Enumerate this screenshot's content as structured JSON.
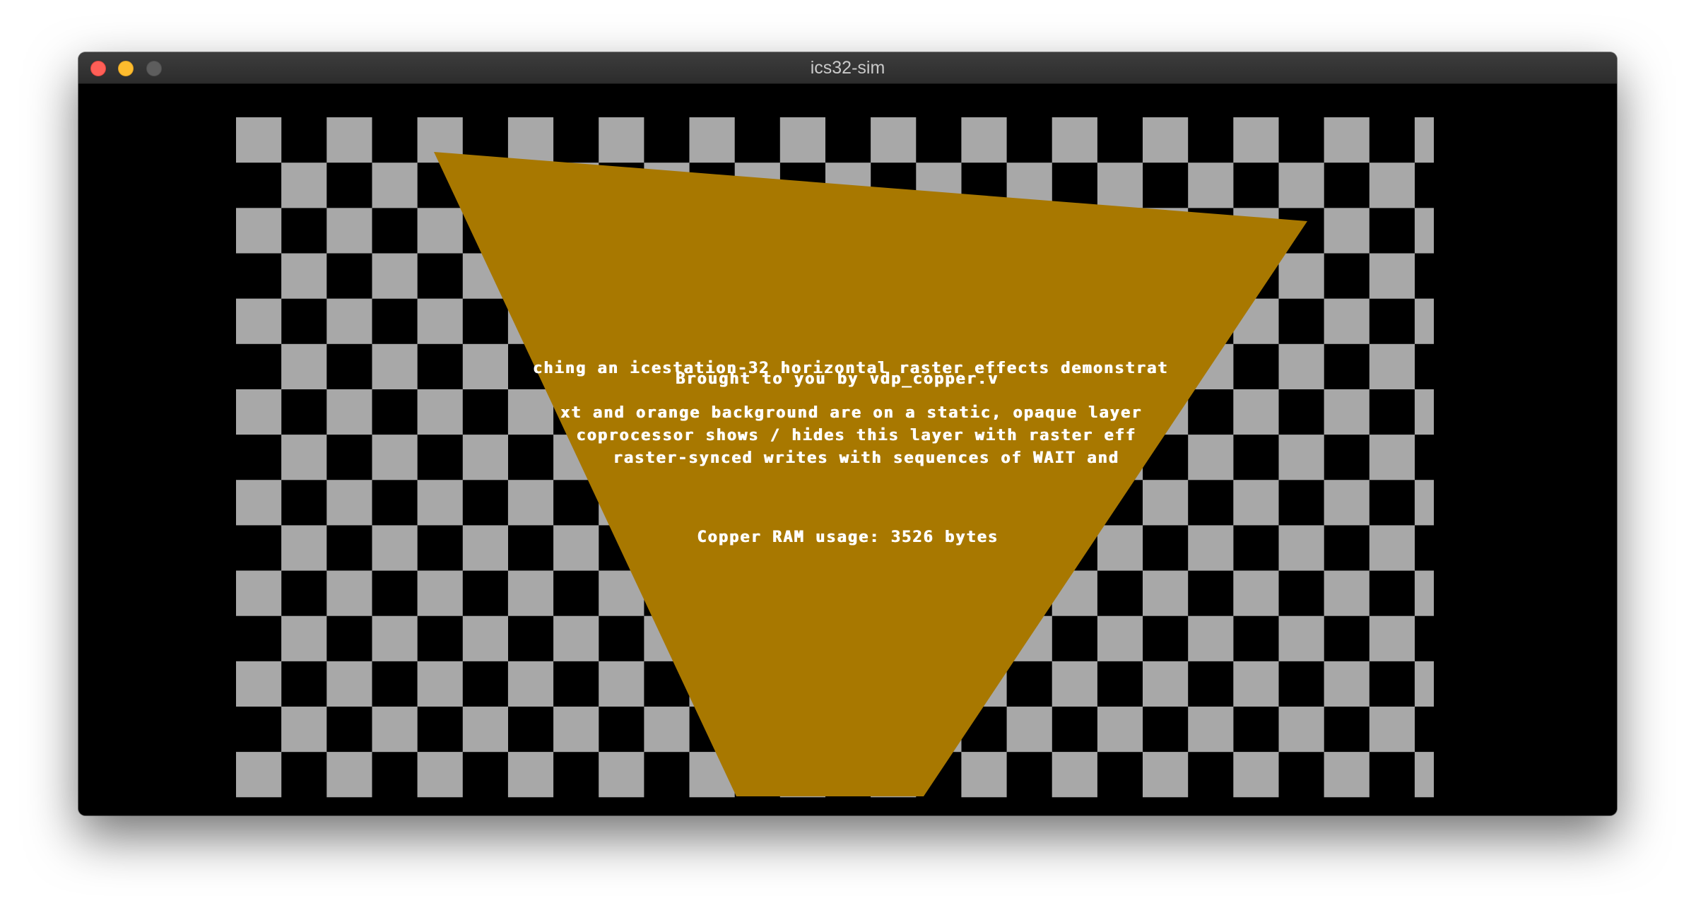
{
  "window": {
    "title": "ics32-sim"
  },
  "display": {
    "colors": {
      "background": "#000000",
      "checker_light": "#a8a8a8",
      "checker_dark": "#000000",
      "polygon": "#a87800",
      "text": "#ffffff"
    },
    "text_lines": [
      "ching an icestation-32 horizontal raster effects demonstrat",
      "Brought to you by vdp_copper.v",
      "xt and orange background are on a static, opaque layer",
      "coprocessor shows / hides this layer with raster eff",
      "raster-synced writes with sequences of WAIT and",
      "Copper RAM usage: 3526 bytes"
    ]
  }
}
